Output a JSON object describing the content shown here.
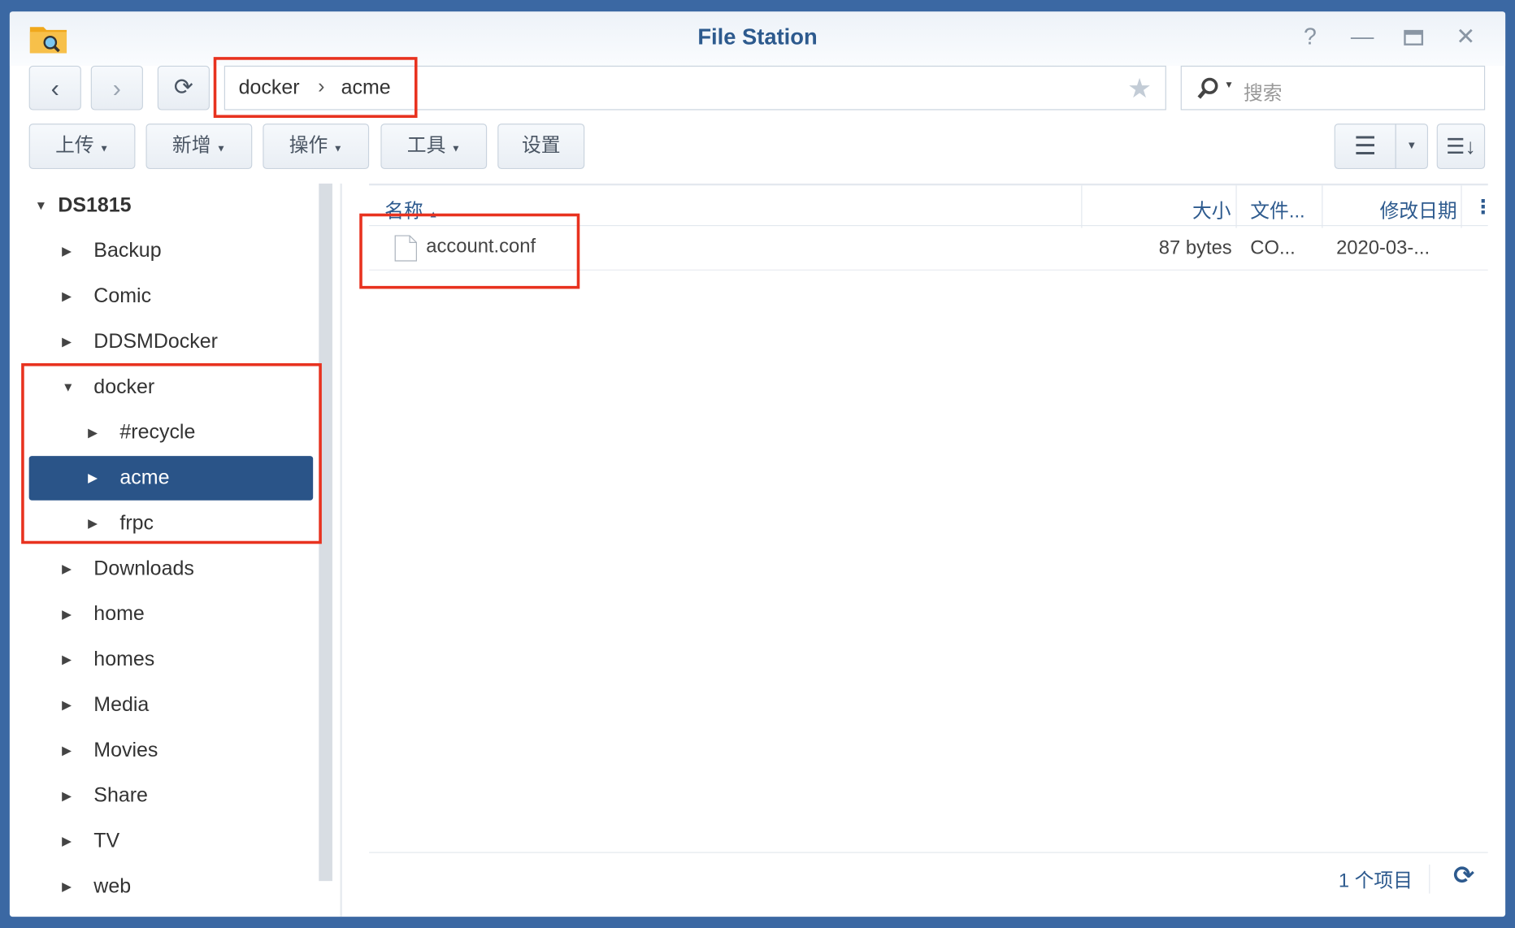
{
  "window": {
    "title": "File Station"
  },
  "nav": {
    "path": [
      "docker",
      "acme"
    ],
    "separator": "›",
    "search_placeholder": "搜索"
  },
  "toolbar": {
    "upload": "上传",
    "create": "新增",
    "action": "操作",
    "tools": "工具",
    "settings": "设置"
  },
  "tree": {
    "root": "DS1815",
    "items": [
      {
        "label": "Backup",
        "level": 1,
        "expanded": false
      },
      {
        "label": "Comic",
        "level": 1,
        "expanded": false
      },
      {
        "label": "DDSMDocker",
        "level": 1,
        "expanded": false
      },
      {
        "label": "docker",
        "level": 1,
        "expanded": true
      },
      {
        "label": "#recycle",
        "level": 2,
        "expanded": false
      },
      {
        "label": "acme",
        "level": 2,
        "expanded": false,
        "selected": true
      },
      {
        "label": "frpc",
        "level": 2,
        "expanded": false
      },
      {
        "label": "Downloads",
        "level": 1,
        "expanded": false
      },
      {
        "label": "home",
        "level": 1,
        "expanded": false
      },
      {
        "label": "homes",
        "level": 1,
        "expanded": false
      },
      {
        "label": "Media",
        "level": 1,
        "expanded": false
      },
      {
        "label": "Movies",
        "level": 1,
        "expanded": false
      },
      {
        "label": "Share",
        "level": 1,
        "expanded": false
      },
      {
        "label": "TV",
        "level": 1,
        "expanded": false
      },
      {
        "label": "web",
        "level": 1,
        "expanded": false
      }
    ]
  },
  "list": {
    "columns": {
      "name": "名称",
      "size": "大小",
      "type": "文件...",
      "modified": "修改日期"
    },
    "rows": [
      {
        "name": "account.conf",
        "size": "87 bytes",
        "type": "CO...",
        "modified": "2020-03-..."
      }
    ]
  },
  "footer": {
    "count": "1 个项目"
  },
  "colors": {
    "accent": "#2a5488",
    "highlight": "#e8321f"
  }
}
